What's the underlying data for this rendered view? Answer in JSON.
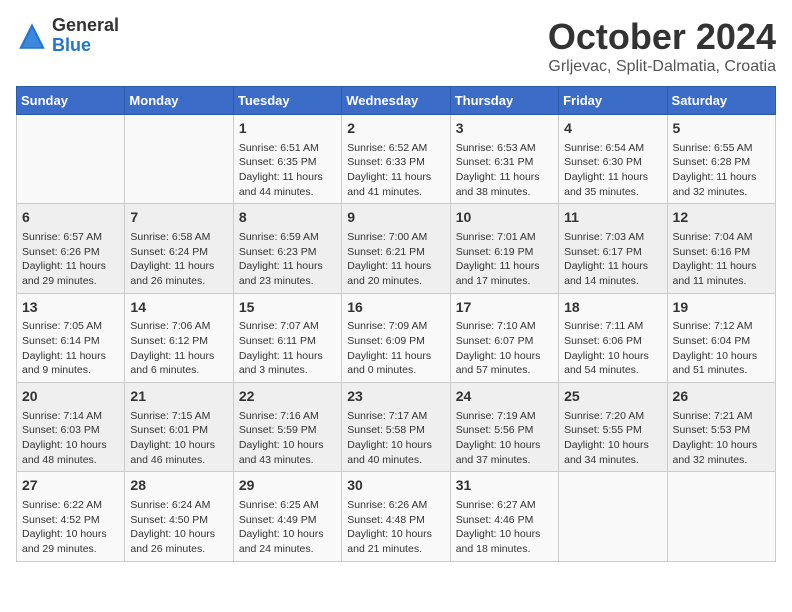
{
  "logo": {
    "general": "General",
    "blue": "Blue"
  },
  "title": "October 2024",
  "subtitle": "Grljevac, Split-Dalmatia, Croatia",
  "headers": [
    "Sunday",
    "Monday",
    "Tuesday",
    "Wednesday",
    "Thursday",
    "Friday",
    "Saturday"
  ],
  "weeks": [
    [
      {
        "day": "",
        "content": ""
      },
      {
        "day": "",
        "content": ""
      },
      {
        "day": "1",
        "content": "Sunrise: 6:51 AM\nSunset: 6:35 PM\nDaylight: 11 hours and 44 minutes."
      },
      {
        "day": "2",
        "content": "Sunrise: 6:52 AM\nSunset: 6:33 PM\nDaylight: 11 hours and 41 minutes."
      },
      {
        "day": "3",
        "content": "Sunrise: 6:53 AM\nSunset: 6:31 PM\nDaylight: 11 hours and 38 minutes."
      },
      {
        "day": "4",
        "content": "Sunrise: 6:54 AM\nSunset: 6:30 PM\nDaylight: 11 hours and 35 minutes."
      },
      {
        "day": "5",
        "content": "Sunrise: 6:55 AM\nSunset: 6:28 PM\nDaylight: 11 hours and 32 minutes."
      }
    ],
    [
      {
        "day": "6",
        "content": "Sunrise: 6:57 AM\nSunset: 6:26 PM\nDaylight: 11 hours and 29 minutes."
      },
      {
        "day": "7",
        "content": "Sunrise: 6:58 AM\nSunset: 6:24 PM\nDaylight: 11 hours and 26 minutes."
      },
      {
        "day": "8",
        "content": "Sunrise: 6:59 AM\nSunset: 6:23 PM\nDaylight: 11 hours and 23 minutes."
      },
      {
        "day": "9",
        "content": "Sunrise: 7:00 AM\nSunset: 6:21 PM\nDaylight: 11 hours and 20 minutes."
      },
      {
        "day": "10",
        "content": "Sunrise: 7:01 AM\nSunset: 6:19 PM\nDaylight: 11 hours and 17 minutes."
      },
      {
        "day": "11",
        "content": "Sunrise: 7:03 AM\nSunset: 6:17 PM\nDaylight: 11 hours and 14 minutes."
      },
      {
        "day": "12",
        "content": "Sunrise: 7:04 AM\nSunset: 6:16 PM\nDaylight: 11 hours and 11 minutes."
      }
    ],
    [
      {
        "day": "13",
        "content": "Sunrise: 7:05 AM\nSunset: 6:14 PM\nDaylight: 11 hours and 9 minutes."
      },
      {
        "day": "14",
        "content": "Sunrise: 7:06 AM\nSunset: 6:12 PM\nDaylight: 11 hours and 6 minutes."
      },
      {
        "day": "15",
        "content": "Sunrise: 7:07 AM\nSunset: 6:11 PM\nDaylight: 11 hours and 3 minutes."
      },
      {
        "day": "16",
        "content": "Sunrise: 7:09 AM\nSunset: 6:09 PM\nDaylight: 11 hours and 0 minutes."
      },
      {
        "day": "17",
        "content": "Sunrise: 7:10 AM\nSunset: 6:07 PM\nDaylight: 10 hours and 57 minutes."
      },
      {
        "day": "18",
        "content": "Sunrise: 7:11 AM\nSunset: 6:06 PM\nDaylight: 10 hours and 54 minutes."
      },
      {
        "day": "19",
        "content": "Sunrise: 7:12 AM\nSunset: 6:04 PM\nDaylight: 10 hours and 51 minutes."
      }
    ],
    [
      {
        "day": "20",
        "content": "Sunrise: 7:14 AM\nSunset: 6:03 PM\nDaylight: 10 hours and 48 minutes."
      },
      {
        "day": "21",
        "content": "Sunrise: 7:15 AM\nSunset: 6:01 PM\nDaylight: 10 hours and 46 minutes."
      },
      {
        "day": "22",
        "content": "Sunrise: 7:16 AM\nSunset: 5:59 PM\nDaylight: 10 hours and 43 minutes."
      },
      {
        "day": "23",
        "content": "Sunrise: 7:17 AM\nSunset: 5:58 PM\nDaylight: 10 hours and 40 minutes."
      },
      {
        "day": "24",
        "content": "Sunrise: 7:19 AM\nSunset: 5:56 PM\nDaylight: 10 hours and 37 minutes."
      },
      {
        "day": "25",
        "content": "Sunrise: 7:20 AM\nSunset: 5:55 PM\nDaylight: 10 hours and 34 minutes."
      },
      {
        "day": "26",
        "content": "Sunrise: 7:21 AM\nSunset: 5:53 PM\nDaylight: 10 hours and 32 minutes."
      }
    ],
    [
      {
        "day": "27",
        "content": "Sunrise: 6:22 AM\nSunset: 4:52 PM\nDaylight: 10 hours and 29 minutes."
      },
      {
        "day": "28",
        "content": "Sunrise: 6:24 AM\nSunset: 4:50 PM\nDaylight: 10 hours and 26 minutes."
      },
      {
        "day": "29",
        "content": "Sunrise: 6:25 AM\nSunset: 4:49 PM\nDaylight: 10 hours and 24 minutes."
      },
      {
        "day": "30",
        "content": "Sunrise: 6:26 AM\nSunset: 4:48 PM\nDaylight: 10 hours and 21 minutes."
      },
      {
        "day": "31",
        "content": "Sunrise: 6:27 AM\nSunset: 4:46 PM\nDaylight: 10 hours and 18 minutes."
      },
      {
        "day": "",
        "content": ""
      },
      {
        "day": "",
        "content": ""
      }
    ]
  ]
}
